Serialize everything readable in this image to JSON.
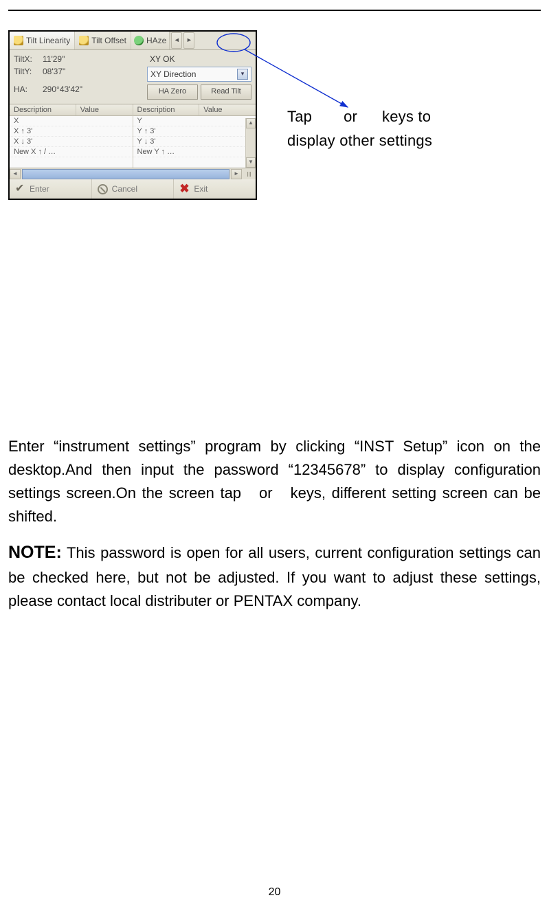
{
  "annotation": {
    "line1_pre": "Tap",
    "line1_mid": "or",
    "line1_post": "keys  to",
    "line2": "display other settings"
  },
  "screenshot": {
    "tabs": [
      {
        "label": "Tilt Linearity",
        "icon": "level-yellow"
      },
      {
        "label": "Tilt Offset",
        "icon": "level-yellow"
      },
      {
        "label": "HAze",
        "icon": "level-green"
      }
    ],
    "nav": {
      "left": "◄",
      "right": "►"
    },
    "readouts": {
      "tiltx_label": "TiltX:",
      "tiltx_value": "11'29\"",
      "tilty_label": "TiltY:",
      "tilty_value": "08'37\"",
      "ha_label": "HA:",
      "ha_value": "290°43'42\"",
      "status": "XY OK",
      "combo": "XY Direction",
      "btn_hazero": "HA Zero",
      "btn_readtilt": "Read Tilt"
    },
    "left_list": {
      "hdr_desc": "Description",
      "hdr_val": "Value",
      "rows": [
        "X",
        "X ↑ 3'",
        "X ↓ 3'",
        "New X ↑ / …"
      ]
    },
    "right_list": {
      "hdr_desc": "Description",
      "hdr_val": "Value",
      "rows": [
        "Y",
        "Y ↑ 3'",
        "Y ↓ 3'",
        "New Y ↑ …"
      ]
    },
    "footer": {
      "enter": "Enter",
      "cancel": "Cancel",
      "exit": "Exit"
    }
  },
  "body": {
    "p1": "Enter “instrument settings” program by clicking “INST Setup” icon on the desktop.And then input the password “12345678” to display configuration settings screen.On the screen tap",
    "p1_mid": "or",
    "p1_tail": "keys, different setting screen can be shifted.",
    "note_label": "NOTE:",
    "note_body": " This password is open for all users, current configuration settings can be checked here, but not be adjusted. If you want to adjust these settings, please contact local distributer or PENTAX company."
  },
  "page_number": "20"
}
